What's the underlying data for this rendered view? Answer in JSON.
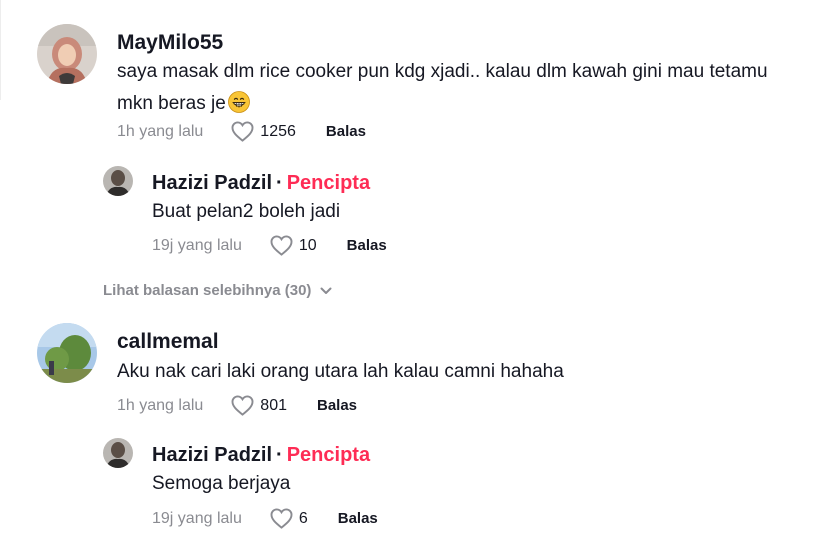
{
  "comments": [
    {
      "username": "MayMilo55",
      "text_line1": "saya masak dlm rice cooker pun kdg xjadi.. kalau dlm kawah gini mau tetamu",
      "text_line2": "mkn beras je",
      "emoji": "grinning-face-emoji",
      "time": "1h yang lalu",
      "likes": "1256",
      "reply_label": "Balas",
      "replies": [
        {
          "username": "Hazizi Padzil",
          "separator": "·",
          "badge": "Pencipta",
          "text": "Buat pelan2 boleh jadi",
          "time": "19j yang lalu",
          "likes": "10",
          "reply_label": "Balas"
        }
      ],
      "more_replies": "Lihat balasan selebihnya (30)"
    },
    {
      "username": "callmemal",
      "text": "Aku nak cari laki orang utara lah kalau camni hahaha",
      "time": "1h yang lalu",
      "likes": "801",
      "reply_label": "Balas",
      "replies": [
        {
          "username": "Hazizi Padzil",
          "separator": "·",
          "badge": "Pencipta",
          "text": "Semoga berjaya",
          "time": "19j yang lalu",
          "likes": "6",
          "reply_label": "Balas"
        }
      ]
    }
  ],
  "colors": {
    "creator_badge": "#fe2c55",
    "meta_text": "#8a8b91",
    "text": "#161823"
  },
  "icons": {
    "like": "heart-outline-icon",
    "expand": "chevron-down-icon"
  }
}
